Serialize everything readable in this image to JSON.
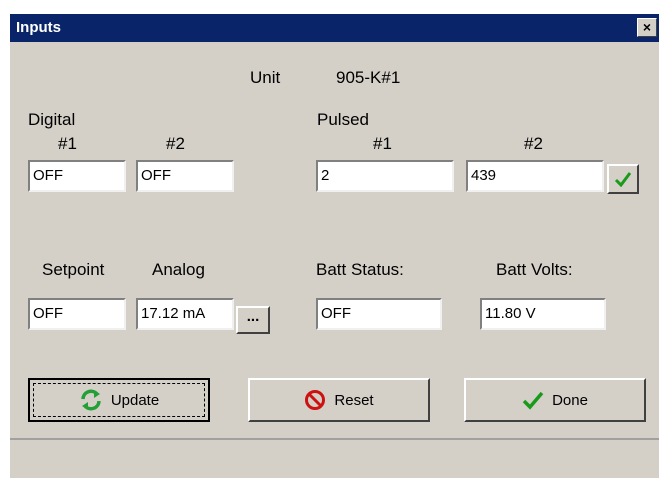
{
  "window": {
    "title": "Inputs",
    "close_label": "×"
  },
  "unit": {
    "label": "Unit",
    "value": "905-K#1"
  },
  "digital": {
    "label": "Digital",
    "col1": "#1",
    "col2": "#2",
    "value1": "OFF",
    "value2": "OFF"
  },
  "pulsed": {
    "label": "Pulsed",
    "col1": "#1",
    "col2": "#2",
    "value1": "2",
    "value2": "439"
  },
  "setpoint": {
    "label": "Setpoint",
    "value": "OFF"
  },
  "analog": {
    "label": "Analog",
    "value": "17.12 mA",
    "browse_label": "..."
  },
  "batt_status": {
    "label": "Batt Status:",
    "value": "OFF"
  },
  "batt_volts": {
    "label": "Batt Volts:",
    "value": "11.80 V"
  },
  "buttons": {
    "update": "Update",
    "reset": "Reset",
    "done": "Done"
  },
  "colors": {
    "title_bar": "#0a246a",
    "face": "#d4d0c8",
    "update_icon": "#22a035",
    "reset_icon": "#cc1111",
    "done_icon": "#1a9a1a"
  },
  "icons": {
    "apply": "checkmark-icon",
    "update": "refresh-icon",
    "reset": "no-entry-icon",
    "done": "checkmark-icon"
  }
}
